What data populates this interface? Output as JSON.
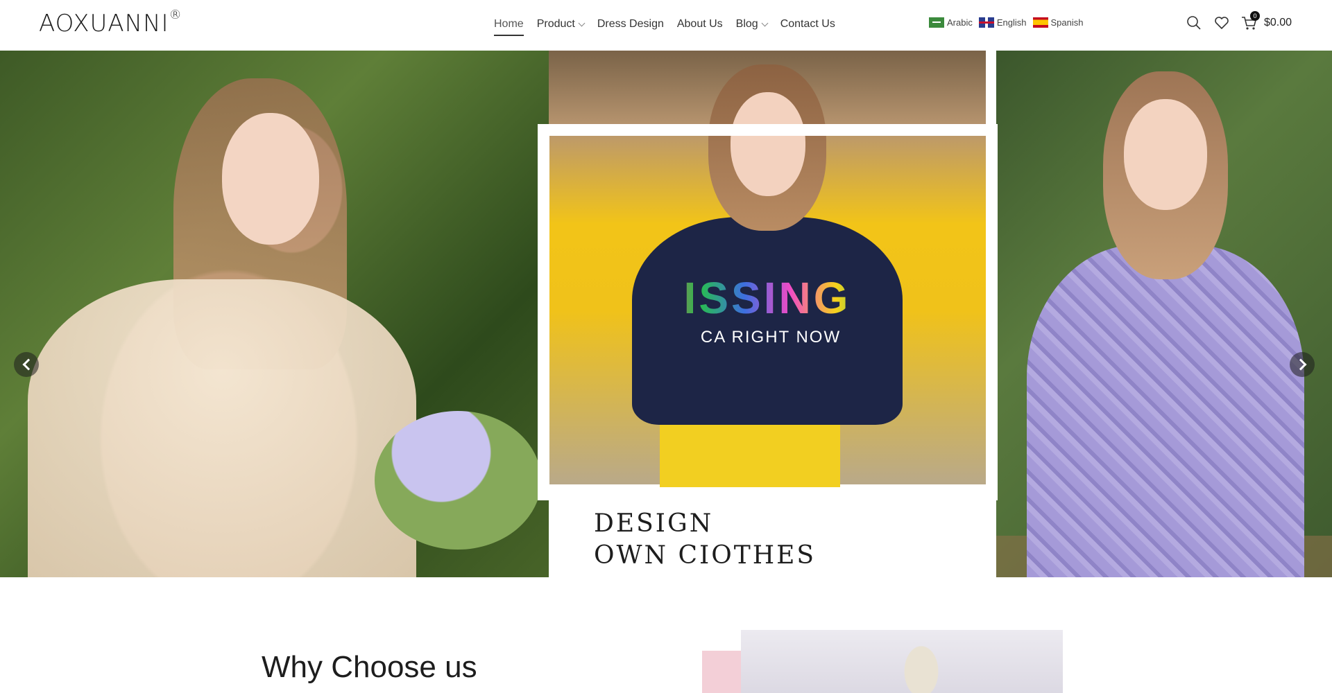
{
  "brand": {
    "name": "AOXUANNI",
    "mark": "®"
  },
  "nav": [
    {
      "label": "Home",
      "active": true,
      "dropdown": false
    },
    {
      "label": "Product",
      "active": false,
      "dropdown": true
    },
    {
      "label": "Dress Design",
      "active": false,
      "dropdown": false
    },
    {
      "label": "About Us",
      "active": false,
      "dropdown": false
    },
    {
      "label": "Blog",
      "active": false,
      "dropdown": true
    },
    {
      "label": "Contact Us",
      "active": false,
      "dropdown": false
    }
  ],
  "languages": [
    {
      "label": "Arabic",
      "flag": "saudi-flag-icon"
    },
    {
      "label": "English",
      "flag": "uk-flag-icon"
    },
    {
      "label": "Spanish",
      "flag": "spain-flag-icon"
    }
  ],
  "header_icons": {
    "search": "search-icon",
    "wishlist": "heart-icon",
    "cart": "cart-icon"
  },
  "cart": {
    "count": "0",
    "total": "$0.00"
  },
  "hero": {
    "caption_line1": "DESIGN",
    "caption_line2": "OWN CIOTHES",
    "shirt_text": "ISSING",
    "shirt_subtext": "CA RIGHT NOW",
    "slides": 3,
    "active_slide": 2
  },
  "section": {
    "title": "Why Choose us"
  },
  "colors": {
    "accent_pink": "#f3cfd7",
    "text": "#222222"
  }
}
